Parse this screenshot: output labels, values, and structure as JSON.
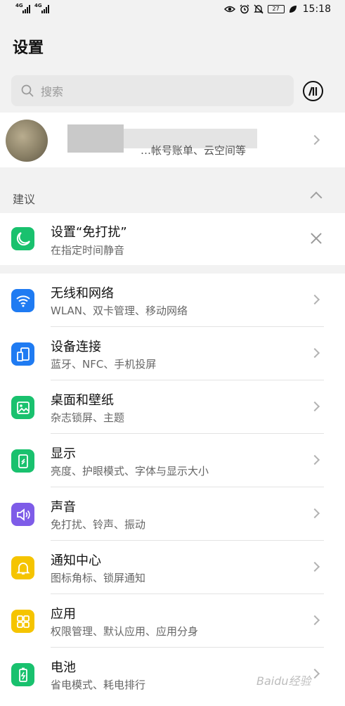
{
  "status_bar": {
    "sim1_tag": "4G",
    "sim2_tag": "4G",
    "battery": "27",
    "time": "15:18",
    "icons": [
      "eye-comfort-icon",
      "alarm-icon",
      "mute-bell-icon",
      "battery-icon",
      "leaf-icon"
    ]
  },
  "page": {
    "title": "设置"
  },
  "search": {
    "placeholder": "搜索"
  },
  "account": {
    "description": "…帐号账单、云空间等"
  },
  "suggestion": {
    "section_label": "建议",
    "title": "设置“免打扰”",
    "subtitle": "在指定时间静音",
    "icon": "moon-icon",
    "color": "#19c16e"
  },
  "menu": [
    {
      "title": "无线和网络",
      "subtitle": "WLAN、双卡管理、移动网络",
      "icon": "wifi-icon",
      "color": "#1f7bf2"
    },
    {
      "title": "设备连接",
      "subtitle": "蓝牙、NFC、手机投屏",
      "icon": "device-connect-icon",
      "color": "#1f7bf2"
    },
    {
      "title": "桌面和壁纸",
      "subtitle": "杂志锁屏、主题",
      "icon": "wallpaper-icon",
      "color": "#19c16e"
    },
    {
      "title": "显示",
      "subtitle": "亮度、护眼模式、字体与显示大小",
      "icon": "display-icon",
      "color": "#19c16e"
    },
    {
      "title": "声音",
      "subtitle": "免打扰、铃声、振动",
      "icon": "sound-icon",
      "color": "#7e5ce8"
    },
    {
      "title": "通知中心",
      "subtitle": "图标角标、锁屏通知",
      "icon": "bell-icon",
      "color": "#f5c400"
    },
    {
      "title": "应用",
      "subtitle": "权限管理、默认应用、应用分身",
      "icon": "apps-icon",
      "color": "#f5c400"
    },
    {
      "title": "电池",
      "subtitle": "省电模式、耗电排行",
      "icon": "battery-saver-icon",
      "color": "#19c16e"
    }
  ],
  "watermark": "Baidu经验"
}
